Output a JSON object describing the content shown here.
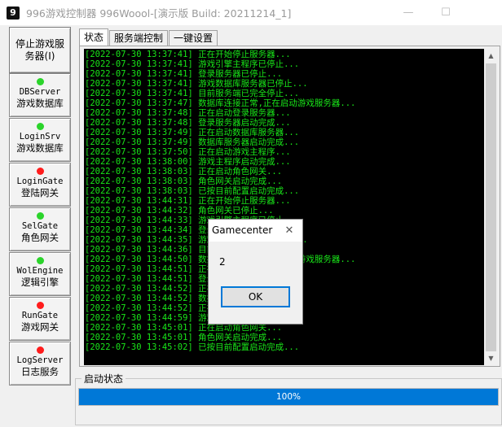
{
  "window": {
    "title": "996游戏控制器    996Woool-[演示版 Build: 20211214_1]",
    "icon_glyph": "9",
    "min_glyph": "—",
    "max_glyph": "☐"
  },
  "sidebar": {
    "stop_button": {
      "line1": "停止游戏服",
      "line2": "务器(I)"
    },
    "services": [
      {
        "name": "DBServer",
        "desc": "游戏数据库",
        "status": "green"
      },
      {
        "name": "LoginSrv",
        "desc": "游戏数据库",
        "status": "green"
      },
      {
        "name": "LoginGate",
        "desc": "登陆网关",
        "status": "red"
      },
      {
        "name": "SelGate",
        "desc": "角色网关",
        "status": "green"
      },
      {
        "name": "WolEngine",
        "desc": "逻辑引擎",
        "status": "green"
      },
      {
        "name": "RunGate",
        "desc": "游戏网关",
        "status": "red"
      },
      {
        "name": "LogServer",
        "desc": "日志服务",
        "status": "red"
      }
    ]
  },
  "tabs": [
    "状态",
    "服务端控制",
    "一键设置"
  ],
  "log": {
    "lines": [
      "[2022-07-30 13:37:41] 正在开始停止服务器...",
      "[2022-07-30 13:37:41] 游戏引擎主程序已停止...",
      "[2022-07-30 13:37:41] 登录服务器已停止...",
      "[2022-07-30 13:37:41] 游戏数据库服务器已停止...",
      "[2022-07-30 13:37:41] 目前服务端已完全停止...",
      "[2022-07-30 13:37:47] 数据库连接正常,正在启动游戏服务器...",
      "[2022-07-30 13:37:48] 正在启动登录服务器...",
      "[2022-07-30 13:37:48] 登录服务器启动完成...",
      "[2022-07-30 13:37:49] 正在启动数据库服务器...",
      "[2022-07-30 13:37:49] 数据库服务器启动完成...",
      "[2022-07-30 13:37:50] 正在启动游戏主程序...",
      "[2022-07-30 13:38:00] 游戏主程序启动完成...",
      "[2022-07-30 13:38:03] 正在启动角色网关...",
      "[2022-07-30 13:38:03] 角色网关启动完成...",
      "[2022-07-30 13:38:03] 已按目前配置启动完成...",
      "[2022-07-30 13:44:31] 正在开始停止服务器...",
      "[2022-07-30 13:44:32] 角色网关已停止...",
      "[2022-07-30 13:44:33] 游戏引擎主程序已停止...",
      "[2022-07-30 13:44:34] 登录服务器已停止...",
      "[2022-07-30 13:44:35] 游戏数据库服务器已停止...",
      "[2022-07-30 13:44:36] 目前服务端已完全停止...",
      "[2022-07-30 13:44:50] 数据库连接正常,正在启动游戏服务器...",
      "[2022-07-30 13:44:51] 正在启动登录服务器...",
      "[2022-07-30 13:44:51] 登录服务器启动完成...",
      "[2022-07-30 13:44:52] 正在启动数据库服务器...",
      "[2022-07-30 13:44:52] 数据库服务器启动完成...",
      "[2022-07-30 13:44:52] 正在启动游戏主程序...",
      "[2022-07-30 13:44:59] 游戏主程序启动完成...",
      "[2022-07-30 13:45:01] 正在启动角色网关...",
      "[2022-07-30 13:45:01] 角色网关启动完成...",
      "[2022-07-30 13:45:02] 已按目前配置启动完成..."
    ]
  },
  "status": {
    "label": "启动状态",
    "progress": 100,
    "progress_text": "100%"
  },
  "dialog": {
    "title": "Gamecenter",
    "message": "2",
    "ok_label": "OK",
    "close_glyph": "✕"
  },
  "colors": {
    "console_bg": "#000000",
    "console_text": "#19e619",
    "led_green": "#2bd42b",
    "led_red": "#ff1c1c",
    "progress": "#0078d7"
  }
}
